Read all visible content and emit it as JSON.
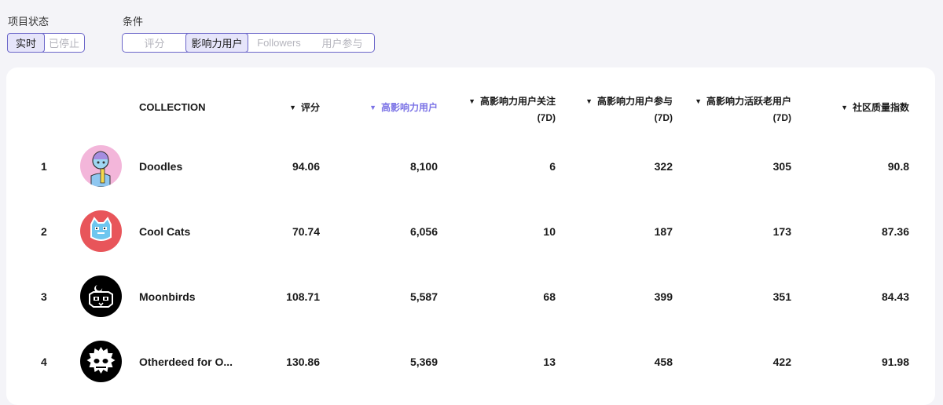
{
  "filters": {
    "status": {
      "label": "项目状态",
      "options": [
        "实时",
        "已停止"
      ],
      "selected": "实时"
    },
    "condition": {
      "label": "条件",
      "options": [
        "评分",
        "影响力用户",
        "Followers",
        "用户参与"
      ],
      "selected": "影响力用户"
    }
  },
  "table": {
    "headers": {
      "collection": "COLLECTION",
      "score": "评分",
      "influencers": "高影响力用户",
      "inf_follow": "高影响力用户关注",
      "inf_engage": "高影响力用户参与",
      "inf_active": "高影响力活跃老用户",
      "community": "社区质量指数",
      "period": "(7D)"
    },
    "sort_column": "influencers",
    "accent_color": "#7b73e6",
    "rows": [
      {
        "rank": "1",
        "name": "Doodles",
        "avatar": "doodles-avatar-icon",
        "score": "94.06",
        "influencers": "8,100",
        "inf_follow": "6",
        "inf_engage": "322",
        "inf_active": "305",
        "community": "90.8"
      },
      {
        "rank": "2",
        "name": "Cool Cats",
        "avatar": "cool-cats-avatar-icon",
        "score": "70.74",
        "influencers": "6,056",
        "inf_follow": "10",
        "inf_engage": "187",
        "inf_active": "173",
        "community": "87.36"
      },
      {
        "rank": "3",
        "name": "Moonbirds",
        "avatar": "moonbirds-avatar-icon",
        "score": "108.71",
        "influencers": "5,587",
        "inf_follow": "68",
        "inf_engage": "399",
        "inf_active": "351",
        "community": "84.43"
      },
      {
        "rank": "4",
        "name": "Otherdeed for O...",
        "avatar": "otherdeed-avatar-icon",
        "score": "130.86",
        "influencers": "5,369",
        "inf_follow": "13",
        "inf_engage": "458",
        "inf_active": "422",
        "community": "91.98"
      }
    ]
  }
}
